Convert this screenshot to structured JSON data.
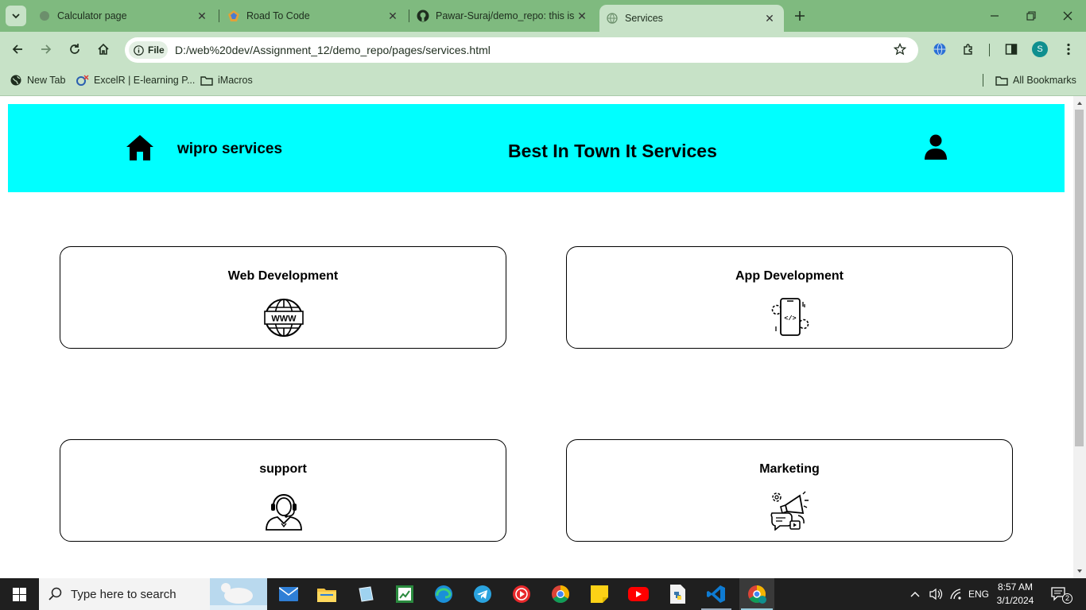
{
  "browser": {
    "tabs": [
      {
        "title": "Calculator page",
        "active": false
      },
      {
        "title": "Road To Code",
        "active": false
      },
      {
        "title": "Pawar-Suraj/demo_repo: this is",
        "active": false
      },
      {
        "title": "Services",
        "active": true
      }
    ],
    "new_tab_icon": "plus-icon",
    "address": {
      "chip_label": "File",
      "url": "D:/web%20dev/Assignment_12/demo_repo/pages/services.html"
    },
    "profile_initial": "S",
    "bookmarks": [
      {
        "label": "New Tab",
        "icon": "globe-icon"
      },
      {
        "label": "ExcelR | E-learning P...",
        "icon": "excelr-icon"
      },
      {
        "label": "iMacros",
        "icon": "folder-icon"
      }
    ],
    "all_bookmarks_label": "All Bookmarks"
  },
  "page": {
    "header": {
      "brand": "wipro services",
      "headline": "Best In Town It Services",
      "background": "#00ffff"
    },
    "services": [
      {
        "title": "Web Development",
        "icon": "www-globe-icon"
      },
      {
        "title": "App Development",
        "icon": "mobile-code-gear-icon"
      },
      {
        "title": "support",
        "icon": "headset-agent-icon"
      },
      {
        "title": "Marketing",
        "icon": "megaphone-marketing-icon"
      }
    ]
  },
  "taskbar": {
    "search_placeholder": "Type here to search",
    "time": "8:57 AM",
    "date": "3/1/2024",
    "language": "ENG",
    "notification_count": "2"
  }
}
